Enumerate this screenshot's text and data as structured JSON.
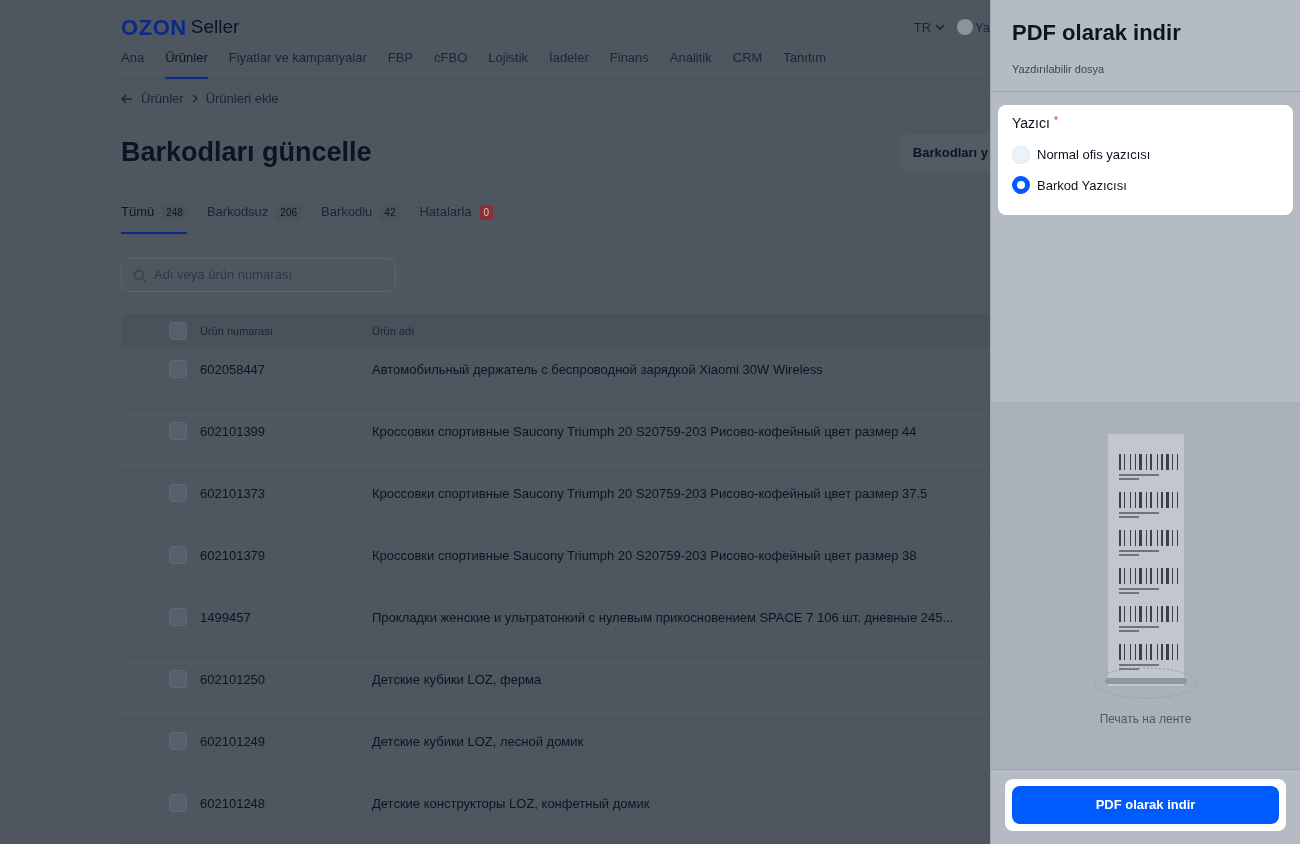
{
  "header": {
    "logo": "OZON",
    "logo_suffix": "Seller",
    "language": "TR",
    "user": "Ya"
  },
  "nav": [
    {
      "label": "Ana",
      "selected": false
    },
    {
      "label": "Ürünler",
      "selected": true
    },
    {
      "label": "Fiyatlar ve kampanyalar",
      "selected": false
    },
    {
      "label": "FBP",
      "selected": false
    },
    {
      "label": "cFBO",
      "selected": false
    },
    {
      "label": "Lojistik",
      "selected": false
    },
    {
      "label": "İadeler",
      "selected": false
    },
    {
      "label": "Finans",
      "selected": false
    },
    {
      "label": "Analitik",
      "selected": false
    },
    {
      "label": "CRM",
      "selected": false
    },
    {
      "label": "Tanıtım",
      "selected": false
    }
  ],
  "breadcrumbs": [
    "Ürünler",
    "Ürünleri ekle"
  ],
  "page_title": "Barkodları güncelle",
  "action_button": "Barkodları y",
  "tabs": [
    {
      "label": "Tümü",
      "count": "248",
      "selected": true,
      "kind": "normal"
    },
    {
      "label": "Barkodsuz",
      "count": "206",
      "selected": false,
      "kind": "normal"
    },
    {
      "label": "Barkodlu",
      "count": "42",
      "selected": false,
      "kind": "normal"
    },
    {
      "label": "Hatalarla",
      "count": "0",
      "selected": false,
      "kind": "error"
    }
  ],
  "search": {
    "placeholder": "Adı veya ürün numarası"
  },
  "table": {
    "columns": [
      "Ürün numarası",
      "Ürün adı"
    ],
    "all_checked": false,
    "rows": [
      {
        "number": "602058447",
        "name": "Автомобильный держатель с беспроводной зарядкой Xiaomi 30W Wireless",
        "checked": false
      },
      {
        "number": "602101399",
        "name": "Кроссовки спортивные Saucony Triumph 20 S20759-203 Рисово-кофейный цвет размер 44",
        "checked": false
      },
      {
        "number": "602101373",
        "name": "Кроссовки спортивные Saucony Triumph 20 S20759-203 Рисово-кофейный цвет размер 37.5",
        "checked": false
      },
      {
        "number": "602101379",
        "name": "Кроссовки спортивные Saucony Triumph 20 S20759-203 Рисово-кофейный цвет размер 38",
        "checked": false
      },
      {
        "number": "1499457",
        "name": "Прокладки женские и ультратонкий с нулевым прикосновением SPACE 7 106 шт. дневные 245...",
        "checked": false
      },
      {
        "number": "602101250",
        "name": "Детские кубики LOZ, ферма",
        "checked": false
      },
      {
        "number": "602101249",
        "name": "Детские кубики LOZ, лесной домик",
        "checked": false
      },
      {
        "number": "602101248",
        "name": "Детские конструкторы LOZ, конфетный домик",
        "checked": false
      }
    ]
  },
  "drawer": {
    "title": "PDF olarak indir",
    "subtitle": "Yazdırılabilir dosya",
    "printer_label": "Yazıcı",
    "required_mark": "*",
    "options": [
      {
        "label": "Normal ofis yazıcısı",
        "selected": false
      },
      {
        "label": "Barkod Yazıcısı",
        "selected": true
      }
    ],
    "preview_caption": "Печать на ленте",
    "button": "PDF olarak indir"
  }
}
